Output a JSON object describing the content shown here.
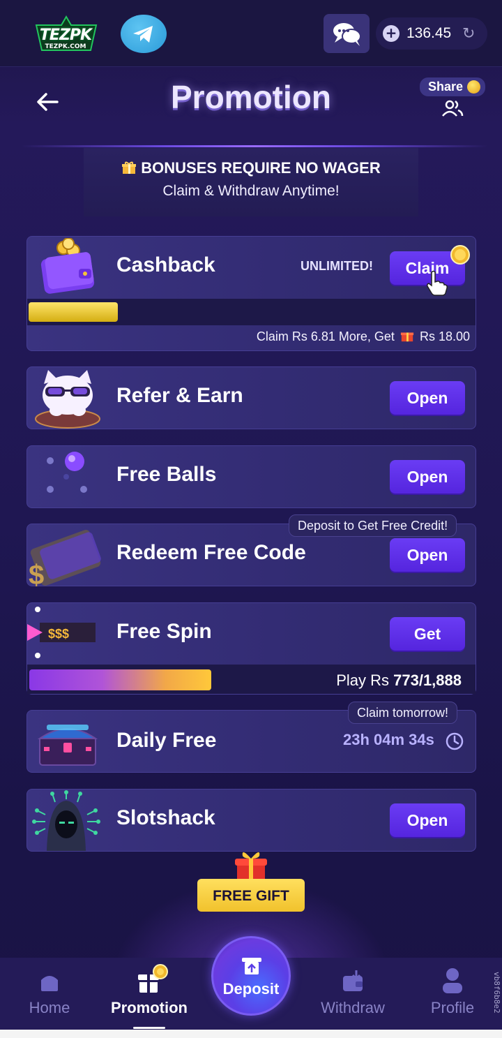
{
  "topbar": {
    "logo_text": "TEZPK",
    "logo_sub": "TEZPK.COM",
    "balance": "136.45"
  },
  "header": {
    "title": "Promotion",
    "share_label": "Share"
  },
  "bonus": {
    "line1": "BONUSES REQUIRE NO WAGER",
    "line2": "Claim & Withdraw Anytime!"
  },
  "cards": {
    "cashback": {
      "title": "Cashback",
      "badge": "UNLIMITED!",
      "button": "Claim",
      "progress": 0.2,
      "note_prefix": "Claim Rs 6.81 More, Get",
      "note_amount": "Rs 18.00"
    },
    "refer": {
      "title": "Refer & Earn",
      "button": "Open"
    },
    "balls": {
      "title": "Free Balls",
      "button": "Open"
    },
    "redeem": {
      "title": "Redeem Free Code",
      "button": "Open",
      "tag": "Deposit to Get Free Credit!"
    },
    "spin": {
      "title": "Free Spin",
      "button": "Get",
      "icon_text": "$$$",
      "play_prefix": "Play Rs",
      "play_value": "773/1,888",
      "progress": 0.409
    },
    "daily": {
      "title": "Daily Free",
      "tag": "Claim tomorrow!",
      "timer": "23h 04m 34s"
    },
    "slotshack": {
      "title": "Slotshack",
      "button": "Open"
    }
  },
  "free_gift": "FREE GIFT",
  "nav": {
    "home": "Home",
    "promotion": "Promotion",
    "deposit": "Deposit",
    "withdraw": "Withdraw",
    "profile": "Profile"
  },
  "version": "vb8f6b8e2",
  "colors": {
    "accent": "#5e2fe8",
    "gold": "#f1c22c",
    "background": "#1f1752"
  }
}
